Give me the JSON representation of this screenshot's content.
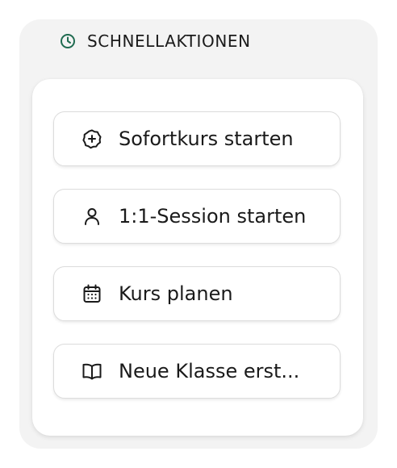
{
  "panel": {
    "title": "SCHNELLAKTIONEN",
    "title_icon": "clock-icon",
    "accent_color": "#1f6b50"
  },
  "actions": [
    {
      "label": "Sofortkurs starten",
      "icon": "plus-circle-icon"
    },
    {
      "label": "1:1-Session starten",
      "icon": "user-icon"
    },
    {
      "label": "Kurs planen",
      "icon": "calendar-icon"
    },
    {
      "label": "Neue Klasse erst...",
      "icon": "book-open-icon"
    }
  ]
}
